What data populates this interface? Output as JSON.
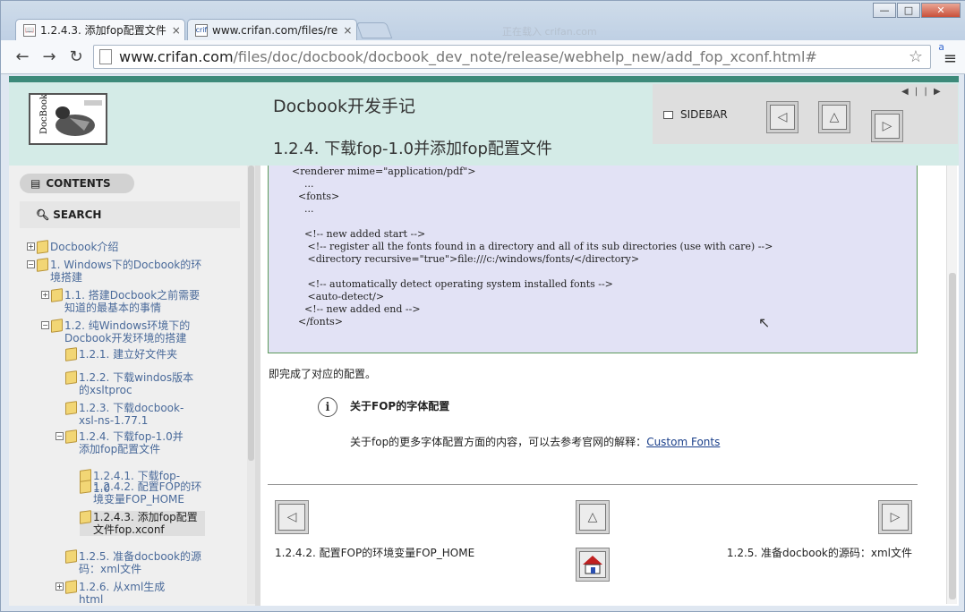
{
  "browser": {
    "tabs": [
      {
        "title": "1.2.4.3. 添加fop配置文件",
        "close": "×"
      },
      {
        "title": "www.crifan.com/files/re",
        "close": "×"
      }
    ],
    "ghost_tab": "正在载入 crifan.com",
    "url_host": "www.crifan.com",
    "url_path": "/files/doc/docbook/docbook_dev_note/release/webhelp_new/add_fop_xconf.html#",
    "window_buttons": {
      "minimize": "—",
      "maximize": "□",
      "close": "✕"
    },
    "nav_icons": [
      "back-arrow-icon",
      "forward-arrow-icon",
      "reload-icon"
    ]
  },
  "header": {
    "logo_text": "DocBook",
    "doc_title": "Docbook开发手记",
    "page_title": "1.2.4. 下载fop-1.0并添加fop配置文件",
    "sidebar_label": "SIDEBAR",
    "mini_nav": "◀ | | ▶"
  },
  "sidebar": {
    "contents_label": "CONTENTS",
    "search_label": "SEARCH",
    "tree": [
      {
        "label": "Docbook介绍",
        "toggle": "+",
        "indent": 0
      },
      {
        "label": "1. Windows下的Docbook的环境搭建",
        "toggle": "−",
        "indent": 0
      },
      {
        "label": "1.1. 搭建Docbook之前需要知道的最基本的事情",
        "toggle": "+",
        "indent": 1
      },
      {
        "label": "1.2. 纯Windows环境下的Docbook开发环境的搭建",
        "toggle": "−",
        "indent": 1
      },
      {
        "label": "1.2.1. 建立好文件夹",
        "toggle": "",
        "indent": 2
      },
      {
        "label": "1.2.2. 下载windos版本的xsltproc",
        "toggle": "",
        "indent": 2
      },
      {
        "label": "1.2.3. 下载docbook-xsl-ns-1.77.1",
        "toggle": "",
        "indent": 2
      },
      {
        "label": "1.2.4. 下载fop-1.0并添加fop配置文件",
        "toggle": "−",
        "indent": 2
      },
      {
        "label": "1.2.4.1. 下载fop-1.0",
        "toggle": "",
        "indent": 3
      },
      {
        "label": "1.2.4.2. 配置FOP的环境变量FOP_HOME",
        "toggle": "",
        "indent": 3
      },
      {
        "label": "1.2.4.3. 添加fop配置文件fop.xconf",
        "toggle": "",
        "indent": 3,
        "selected": true
      },
      {
        "label": "1.2.5. 准备docbook的源码：xml文件",
        "toggle": "",
        "indent": 2
      },
      {
        "label": "1.2.6. 从xml生成html",
        "toggle": "+",
        "indent": 2
      }
    ]
  },
  "main": {
    "code_lines": [
      "<renderer mime=\"application/pdf\">",
      "    ...",
      "  <fonts>",
      "    ...",
      "",
      "    <!-- new added start -->",
      "     <!-- register all the fonts found in a directory and all of its sub directories (use with care) -->",
      "     <directory recursive=\"true\">file:///c:/windows/fonts/</directory>",
      "",
      "     <!-- automatically detect operating system installed fonts -->",
      "     <auto-detect/>",
      "    <!-- new added end -->",
      "  </fonts>"
    ],
    "done_text": "即完成了对应的配置。",
    "note": {
      "icon": "i",
      "title": "关于FOP的字体配置",
      "body": "关于fop的更多字体配置方面的内容，可以去参考官网的解释：",
      "link": "Custom Fonts"
    },
    "footer_nav": {
      "prev_label": "1.2.4.2. 配置FOP的环境变量FOP_HOME",
      "next_label": "1.2.5. 准备docbook的源码：xml文件"
    }
  }
}
